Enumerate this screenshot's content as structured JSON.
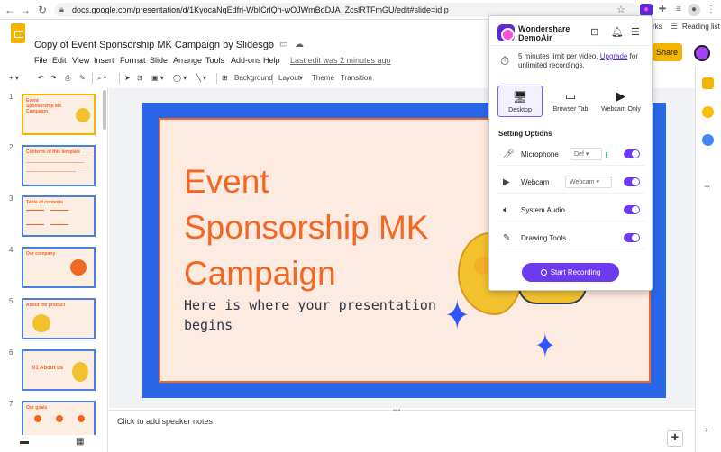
{
  "browser": {
    "url": "docs.google.com/presentation/d/1KyocaNqEdfri-WbICrlQh-wOJWmBoDJA_ZcslRTFmGU/edit#slide=id.p",
    "reading_list": "Reading list",
    "bookmarks_partial": "rks"
  },
  "doc": {
    "title": "Copy of Event Sponsorship MK Campaign by Slidesgo",
    "menu": [
      "File",
      "Edit",
      "View",
      "Insert",
      "Format",
      "Slide",
      "Arrange",
      "Tools",
      "Add-ons",
      "Help"
    ],
    "last_edit": "Last edit was 2 minutes ago",
    "share": "Share"
  },
  "toolbar": {
    "background": "Background",
    "layout": "Layout",
    "theme": "Theme",
    "transition": "Transition"
  },
  "filmstrip": {
    "slides": [
      {
        "num": "1",
        "title": "Event Sponsorship MK Campaign"
      },
      {
        "num": "2",
        "title": "Contents of this template"
      },
      {
        "num": "3",
        "title": "Table of contents"
      },
      {
        "num": "4",
        "title": "Our company"
      },
      {
        "num": "5",
        "title": "About the product"
      },
      {
        "num": "6",
        "title": "01 About us"
      },
      {
        "num": "7",
        "title": "Our goals"
      }
    ]
  },
  "slide": {
    "title": "Event Sponsorship MK Campaign",
    "subtitle": "Here is where your presentation begins"
  },
  "notes": {
    "placeholder": "Click to add speaker notes"
  },
  "demoair": {
    "brand_line1": "Wondershare",
    "brand_line2": "DemoAir",
    "limit_text": "5 minutes limit per video.",
    "upgrade": "Upgrade",
    "limit_suffix": "for unlimited recordings.",
    "modes": [
      "Desktop",
      "Browser Tab",
      "Webcam Only"
    ],
    "setting_options": "Setting Options",
    "settings": {
      "microphone": {
        "label": "Microphone",
        "value": "Def"
      },
      "webcam": {
        "label": "Webcam",
        "value": "Webcam"
      },
      "system_audio": {
        "label": "System Audio"
      },
      "drawing_tools": {
        "label": "Drawing Tools"
      }
    },
    "start_recording": "Start Recording",
    "accent_color": "#6c3bf0"
  }
}
